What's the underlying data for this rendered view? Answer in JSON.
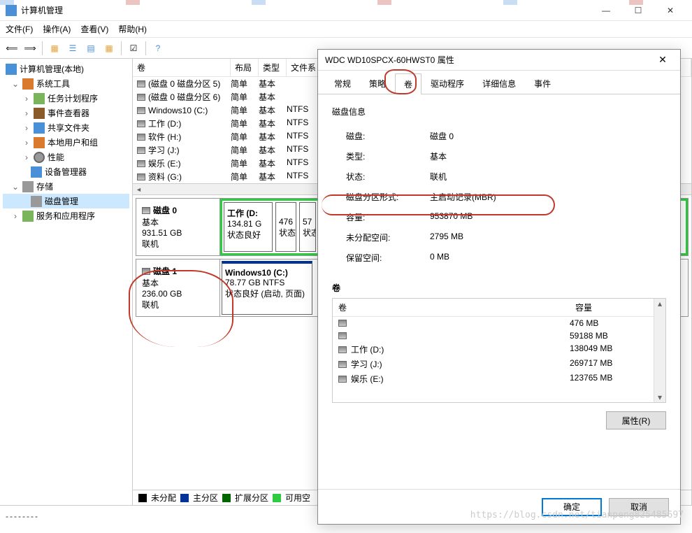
{
  "window": {
    "title": "计算机管理",
    "min": "—",
    "max": "☐",
    "close": "✕"
  },
  "menu": {
    "file": "文件(F)",
    "action": "操作(A)",
    "view": "查看(V)",
    "help": "帮助(H)"
  },
  "tree": {
    "root": "计算机管理(本地)",
    "tools": "系统工具",
    "sched": "任务计划程序",
    "event": "事件查看器",
    "share": "共享文件夹",
    "users": "本地用户和组",
    "perf": "性能",
    "dev": "设备管理器",
    "storage": "存储",
    "disk": "磁盘管理",
    "svc": "服务和应用程序"
  },
  "volhead": {
    "c1": "卷",
    "c2": "布局",
    "c3": "类型",
    "c4": "文件系"
  },
  "vols": [
    {
      "name": "(磁盘 0 磁盘分区 5)",
      "layout": "简单",
      "type": "基本",
      "fs": ""
    },
    {
      "name": "(磁盘 0 磁盘分区 6)",
      "layout": "简单",
      "type": "基本",
      "fs": ""
    },
    {
      "name": "Windows10 (C:)",
      "layout": "简单",
      "type": "基本",
      "fs": "NTFS"
    },
    {
      "name": "工作 (D:)",
      "layout": "简单",
      "type": "基本",
      "fs": "NTFS"
    },
    {
      "name": "软件 (H:)",
      "layout": "简单",
      "type": "基本",
      "fs": "NTFS"
    },
    {
      "name": "学习 (J:)",
      "layout": "简单",
      "type": "基本",
      "fs": "NTFS"
    },
    {
      "name": "娱乐 (E:)",
      "layout": "简单",
      "type": "基本",
      "fs": "NTFS"
    },
    {
      "name": "资料 (G:)",
      "layout": "简单",
      "type": "基本",
      "fs": "NTFS"
    }
  ],
  "disk0": {
    "title": "磁盘 0",
    "type": "基本",
    "size": "931.51 GB",
    "status": "联机"
  },
  "disk0parts": {
    "p1t": "工作 (D:",
    "p1s": "134.81 G",
    "p1st": "状态良好",
    "p2s": "476",
    "p2st": "状态",
    "p3s": "57",
    "p3st": "状态"
  },
  "disk1": {
    "title": "磁盘 1",
    "type": "基本",
    "size": "236.00 GB",
    "status": "联机"
  },
  "disk1parts": {
    "p1t": "Windows10  (C:)",
    "p1s": "78.77 GB NTFS",
    "p1st": "状态良好 (启动, 页面)"
  },
  "legend": {
    "l1": "未分配",
    "l2": "主分区",
    "l3": "扩展分区",
    "l4": "可用空"
  },
  "status": "--------",
  "dialog": {
    "title": "WDC WD10SPCX-60HWST0 属性",
    "tabs": {
      "gen": "常规",
      "pol": "策略",
      "vol": "卷",
      "drv": "驱动程序",
      "det": "详细信息",
      "evt": "事件"
    },
    "sec_disk": "磁盘信息",
    "rows": {
      "disk_l": "磁盘:",
      "disk_v": "磁盘 0",
      "type_l": "类型:",
      "type_v": "基本",
      "stat_l": "状态:",
      "stat_v": "联机",
      "ps_l": "磁盘分区形式:",
      "ps_v": "主启动记录(MBR)",
      "cap_l": "容量:",
      "cap_v": "953870 MB",
      "free_l": "未分配空间:",
      "free_v": "2795 MB",
      "res_l": "保留空间:",
      "res_v": "0 MB"
    },
    "sec_vol": "卷",
    "vb_head": {
      "c1": "卷",
      "c2": "容量"
    },
    "vb_rows": [
      {
        "name": "",
        "cap": "476 MB"
      },
      {
        "name": "",
        "cap": "59188 MB"
      },
      {
        "name": "工作 (D:)",
        "cap": "138049 MB"
      },
      {
        "name": "学习 (J:)",
        "cap": "269717 MB"
      },
      {
        "name": "娱乐 (E:)",
        "cap": "123765 MB"
      }
    ],
    "prop_btn": "属性(R)",
    "ok": "确定",
    "cancel": "取消"
  },
  "watermark": "https://blog.csdn.net/tianpeng825485697"
}
